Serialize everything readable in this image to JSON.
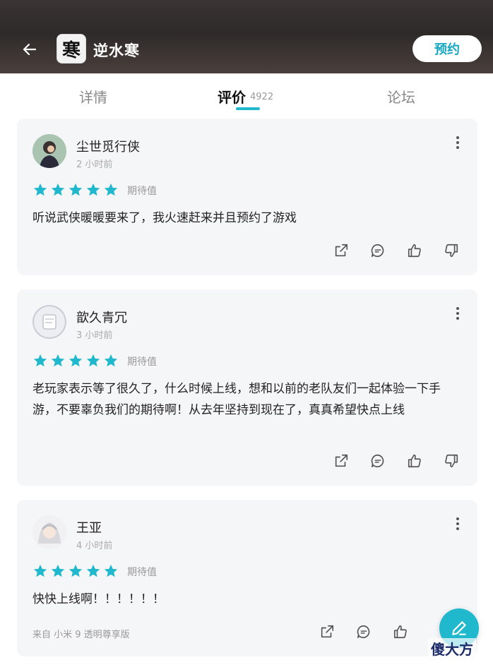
{
  "header": {
    "app_name": "逆水寒",
    "reserve_label": "预约",
    "icon_glyph": "寒"
  },
  "tabs": [
    {
      "label": "详情"
    },
    {
      "label": "评价",
      "count": "4922"
    },
    {
      "label": "论坛"
    }
  ],
  "reviews": [
    {
      "username": "尘世觅行侠",
      "time": "2 小时前",
      "rating_label": "期待值",
      "rating": 5,
      "content": "听说武侠暖暖要来了，我火速赶来并且预约了游戏"
    },
    {
      "username": "歆久青冗",
      "time": "3 小时前",
      "rating_label": "期待值",
      "rating": 5,
      "content": "老玩家表示等了很久了，什么时候上线，想和以前的老队友们一起体验一下手游，不要辜负我们的期待啊！从去年坚持到现在了，真真希望快点上线"
    },
    {
      "username": "王亚",
      "time": "4 小时前",
      "rating_label": "期待值",
      "rating": 5,
      "content": "快快上线啊！！！！！！",
      "source": "来自 小米 9 透明尊享版"
    }
  ],
  "watermark": "傻大方",
  "colors": {
    "accent": "#1fb8cc",
    "header_bg": "#2e2a2a",
    "card_bg": "#f5f6f8"
  },
  "icons": [
    "back-arrow-icon",
    "more-icon",
    "share-icon",
    "comment-icon",
    "thumbs-up-icon",
    "thumbs-down-icon",
    "star-icon",
    "edit-pen-icon"
  ]
}
